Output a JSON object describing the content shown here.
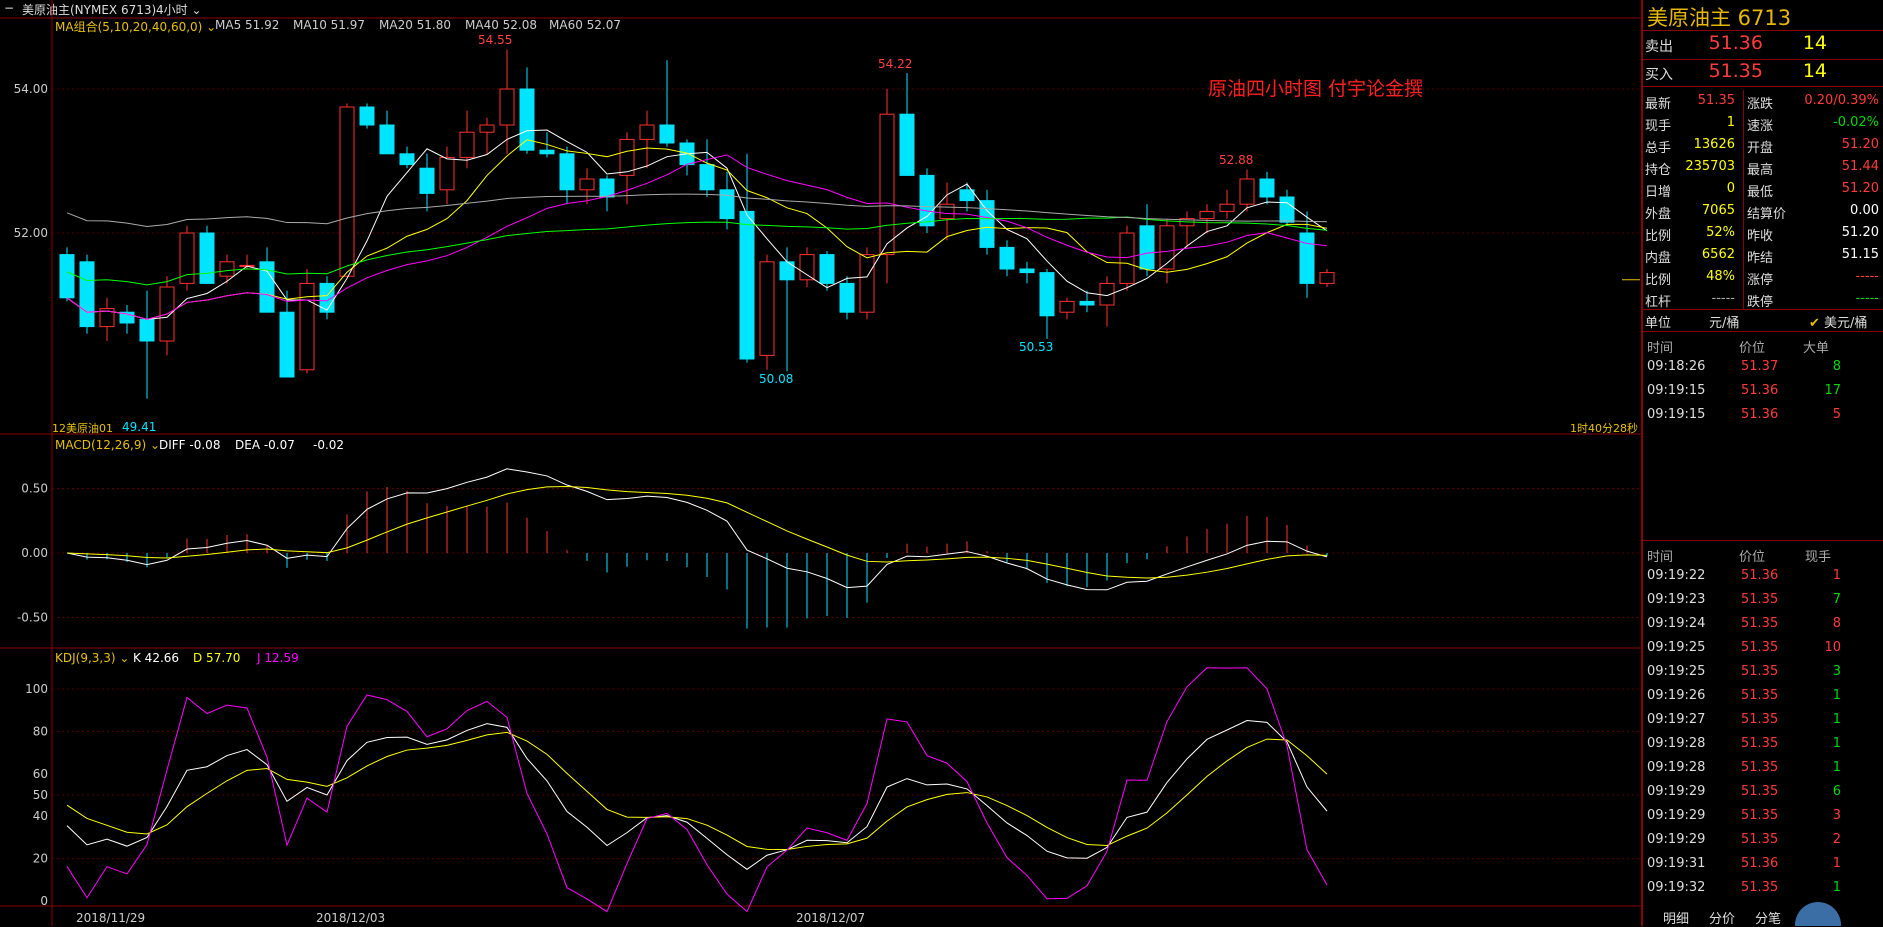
{
  "titlebar": {
    "icon": "minus-icon",
    "instrument": "美原油主(NYMEX 6713)",
    "period": "4小时"
  },
  "main": {
    "legend": {
      "name": "MA组合(5,10,20,40,60,0)",
      "items": [
        {
          "label": "MA5 51.92",
          "color": "#ffffff"
        },
        {
          "label": "MA10 51.97",
          "color": "#ffff00"
        },
        {
          "label": "MA20 51.80",
          "color": "#ff00ff"
        },
        {
          "label": "MA40 52.08",
          "color": "#00ff00"
        },
        {
          "label": "MA60 52.07",
          "color": "#aaaaaa"
        }
      ]
    },
    "watermark": "原油四小时图  付宇论金撰",
    "annotations": [
      "54.55",
      "54.22",
      "52.88",
      "50.08",
      "50.53",
      "49.41"
    ],
    "footer_left": "12美原油01",
    "footer_right": "1时40分28秒"
  },
  "macd": {
    "name": "MACD(12,26,9)",
    "items": [
      {
        "label": "DIFF -0.08",
        "color": "#ffffff"
      },
      {
        "label": "DEA -0.07",
        "color": "#ffff00"
      },
      {
        "label": "-0.02",
        "color": "#ffffff"
      }
    ]
  },
  "kdj": {
    "name": "KDJ(9,3,3)",
    "items": [
      {
        "label": "K 42.66",
        "color": "#ffffff"
      },
      {
        "label": "D 57.70",
        "color": "#ffff00"
      },
      {
        "label": "J 12.59",
        "color": "#ff00ff"
      }
    ]
  },
  "x_axis_dates": [
    "2018/11/29",
    "2018/12/03",
    "2018/12/07"
  ],
  "chart_data": {
    "type": "candlestick",
    "price_ylim": [
      49.0,
      55.0
    ],
    "price_ticks": [
      "54.00",
      "52.00"
    ],
    "macd_ticks": [
      "0.50",
      "0.00",
      "-0.50"
    ],
    "kdj_ticks": [
      "100",
      "80",
      "60",
      "50",
      "40",
      "20",
      "0"
    ],
    "candles": [
      {
        "o": 51.7,
        "h": 51.8,
        "l": 51.05,
        "c": 51.1
      },
      {
        "o": 51.6,
        "h": 51.7,
        "l": 50.6,
        "c": 50.7
      },
      {
        "o": 50.7,
        "h": 51.1,
        "l": 50.5,
        "c": 50.95
      },
      {
        "o": 50.9,
        "h": 51.0,
        "l": 50.6,
        "c": 50.75
      },
      {
        "o": 50.8,
        "h": 51.2,
        "l": 49.7,
        "c": 50.5
      },
      {
        "o": 50.5,
        "h": 51.4,
        "l": 50.3,
        "c": 51.25
      },
      {
        "o": 51.3,
        "h": 52.1,
        "l": 51.2,
        "c": 52.0
      },
      {
        "o": 52.0,
        "h": 52.1,
        "l": 51.3,
        "c": 51.3
      },
      {
        "o": 51.4,
        "h": 51.7,
        "l": 51.3,
        "c": 51.6
      },
      {
        "o": 51.55,
        "h": 51.7,
        "l": 51.5,
        "c": 51.55
      },
      {
        "o": 51.6,
        "h": 51.8,
        "l": 50.9,
        "c": 50.9
      },
      {
        "o": 50.9,
        "h": 51.2,
        "l": 50.0,
        "c": 50.0
      },
      {
        "o": 50.1,
        "h": 51.5,
        "l": 50.05,
        "c": 51.3
      },
      {
        "o": 51.3,
        "h": 51.4,
        "l": 50.8,
        "c": 50.9
      },
      {
        "o": 51.4,
        "h": 53.8,
        "l": 52.0,
        "c": 53.75
      },
      {
        "o": 53.75,
        "h": 53.8,
        "l": 53.45,
        "c": 53.5
      },
      {
        "o": 53.5,
        "h": 53.7,
        "l": 53.1,
        "c": 53.1
      },
      {
        "o": 53.1,
        "h": 53.2,
        "l": 52.9,
        "c": 52.95
      },
      {
        "o": 52.9,
        "h": 53.1,
        "l": 52.3,
        "c": 52.55
      },
      {
        "o": 52.6,
        "h": 53.2,
        "l": 52.4,
        "c": 53.05
      },
      {
        "o": 53.05,
        "h": 53.7,
        "l": 52.9,
        "c": 53.4
      },
      {
        "o": 53.4,
        "h": 53.6,
        "l": 53.1,
        "c": 53.5
      },
      {
        "o": 53.5,
        "h": 54.55,
        "l": 53.1,
        "c": 54.0
      },
      {
        "o": 54.0,
        "h": 54.3,
        "l": 53.1,
        "c": 53.15
      },
      {
        "o": 53.15,
        "h": 53.4,
        "l": 53.05,
        "c": 53.1
      },
      {
        "o": 53.1,
        "h": 53.2,
        "l": 52.4,
        "c": 52.6
      },
      {
        "o": 52.6,
        "h": 52.9,
        "l": 52.4,
        "c": 52.75
      },
      {
        "o": 52.75,
        "h": 52.8,
        "l": 52.3,
        "c": 52.5
      },
      {
        "o": 52.8,
        "h": 53.4,
        "l": 52.4,
        "c": 53.3
      },
      {
        "o": 53.3,
        "h": 53.7,
        "l": 52.9,
        "c": 53.5
      },
      {
        "o": 53.5,
        "h": 54.4,
        "l": 53.2,
        "c": 53.25
      },
      {
        "o": 53.25,
        "h": 53.3,
        "l": 52.8,
        "c": 52.95
      },
      {
        "o": 52.95,
        "h": 53.3,
        "l": 52.5,
        "c": 52.6
      },
      {
        "o": 52.6,
        "h": 52.85,
        "l": 52.05,
        "c": 52.2
      },
      {
        "o": 52.3,
        "h": 53.1,
        "l": 50.2,
        "c": 50.25
      },
      {
        "o": 50.3,
        "h": 51.7,
        "l": 50.1,
        "c": 51.6
      },
      {
        "o": 51.6,
        "h": 51.8,
        "l": 50.08,
        "c": 51.35
      },
      {
        "o": 51.35,
        "h": 51.8,
        "l": 51.25,
        "c": 51.7
      },
      {
        "o": 51.7,
        "h": 51.75,
        "l": 51.2,
        "c": 51.3
      },
      {
        "o": 51.3,
        "h": 51.4,
        "l": 50.8,
        "c": 50.9
      },
      {
        "o": 50.9,
        "h": 51.8,
        "l": 50.8,
        "c": 51.7
      },
      {
        "o": 51.7,
        "h": 54.0,
        "l": 51.3,
        "c": 53.65
      },
      {
        "o": 53.65,
        "h": 54.22,
        "l": 52.8,
        "c": 52.8
      },
      {
        "o": 52.8,
        "h": 52.9,
        "l": 52.0,
        "c": 52.1
      },
      {
        "o": 52.2,
        "h": 52.7,
        "l": 51.9,
        "c": 52.4
      },
      {
        "o": 52.6,
        "h": 52.7,
        "l": 52.3,
        "c": 52.45
      },
      {
        "o": 52.45,
        "h": 52.6,
        "l": 51.7,
        "c": 51.8
      },
      {
        "o": 51.8,
        "h": 51.9,
        "l": 51.4,
        "c": 51.5
      },
      {
        "o": 51.5,
        "h": 51.6,
        "l": 51.3,
        "c": 51.45
      },
      {
        "o": 51.45,
        "h": 51.5,
        "l": 50.53,
        "c": 50.85
      },
      {
        "o": 50.9,
        "h": 51.1,
        "l": 50.8,
        "c": 51.05
      },
      {
        "o": 51.05,
        "h": 51.2,
        "l": 50.9,
        "c": 51.0
      },
      {
        "o": 51.0,
        "h": 51.4,
        "l": 50.7,
        "c": 51.3
      },
      {
        "o": 51.3,
        "h": 52.1,
        "l": 51.2,
        "c": 52.0
      },
      {
        "o": 52.1,
        "h": 52.4,
        "l": 51.4,
        "c": 51.5
      },
      {
        "o": 51.5,
        "h": 52.2,
        "l": 51.3,
        "c": 52.1
      },
      {
        "o": 52.1,
        "h": 52.3,
        "l": 51.8,
        "c": 52.2
      },
      {
        "o": 52.2,
        "h": 52.4,
        "l": 52.0,
        "c": 52.3
      },
      {
        "o": 52.3,
        "h": 52.6,
        "l": 52.2,
        "c": 52.4
      },
      {
        "o": 52.4,
        "h": 52.88,
        "l": 52.3,
        "c": 52.75
      },
      {
        "o": 52.75,
        "h": 52.85,
        "l": 52.4,
        "c": 52.5
      },
      {
        "o": 52.5,
        "h": 52.6,
        "l": 52.1,
        "c": 52.15
      },
      {
        "o": 52.0,
        "h": 52.3,
        "l": 51.1,
        "c": 51.3
      },
      {
        "o": 51.3,
        "h": 51.5,
        "l": 51.25,
        "c": 51.45
      }
    ]
  },
  "quote": {
    "title": "美原油主  6713",
    "sell": {
      "label": "卖出",
      "price": "51.36",
      "qty": "14"
    },
    "buy": {
      "label": "买入",
      "price": "51.35",
      "qty": "14"
    },
    "rows": [
      {
        "l1": "最新",
        "v1": "51.35",
        "c1": "red",
        "l2": "涨跌",
        "v2": "0.20/0.39%",
        "c2": "red"
      },
      {
        "l1": "现手",
        "v1": "1",
        "c1": "yellow",
        "l2": "速涨",
        "v2": "-0.02%",
        "c2": "green"
      },
      {
        "l1": "总手",
        "v1": "13626",
        "c1": "yellow",
        "l2": "开盘",
        "v2": "51.20",
        "c2": "red"
      },
      {
        "l1": "持仓",
        "v1": "235703",
        "c1": "yellow",
        "l2": "最高",
        "v2": "51.44",
        "c2": "red"
      },
      {
        "l1": "日增",
        "v1": "0",
        "c1": "yellow",
        "l2": "最低",
        "v2": "51.20",
        "c2": "red"
      },
      {
        "l1": "外盘",
        "v1": "7065",
        "c1": "yellow",
        "l2": "结算价",
        "v2": "0.00",
        "c2": "white"
      },
      {
        "l1": "比例",
        "v1": "52%",
        "c1": "yellow",
        "l2": "昨收",
        "v2": "51.20",
        "c2": "white"
      },
      {
        "l1": "内盘",
        "v1": "6562",
        "c1": "yellow",
        "l2": "昨结",
        "v2": "51.15",
        "c2": "white"
      },
      {
        "l1": "比例",
        "v1": "48%",
        "c1": "yellow",
        "l2": "涨停",
        "v2": "-----",
        "c2": "red"
      },
      {
        "l1": "杠杆",
        "v1": "-----",
        "c1": "gray",
        "l2": "跌停",
        "v2": "-----",
        "c2": "green"
      }
    ],
    "unit_label": "单位",
    "unit_cny": "元/桶",
    "unit_usd": "美元/桶",
    "big_headers": [
      "时间",
      "价位",
      "大单"
    ],
    "big_orders": [
      {
        "t": "09:18:26",
        "p": "51.37",
        "q": "8",
        "qc": "green"
      },
      {
        "t": "09:19:15",
        "p": "51.36",
        "q": "17",
        "qc": "green"
      },
      {
        "t": "09:19:15",
        "p": "51.36",
        "q": "5",
        "qc": "red"
      }
    ],
    "tick_headers": [
      "时间",
      "价位",
      "现手"
    ],
    "ticks": [
      {
        "t": "09:19:22",
        "p": "51.36",
        "q": "1",
        "qc": "red"
      },
      {
        "t": "09:19:23",
        "p": "51.35",
        "q": "7",
        "qc": "green"
      },
      {
        "t": "09:19:24",
        "p": "51.35",
        "q": "8",
        "qc": "red"
      },
      {
        "t": "09:19:25",
        "p": "51.35",
        "q": "10",
        "qc": "red"
      },
      {
        "t": "09:19:25",
        "p": "51.35",
        "q": "3",
        "qc": "green"
      },
      {
        "t": "09:19:26",
        "p": "51.35",
        "q": "1",
        "qc": "green"
      },
      {
        "t": "09:19:27",
        "p": "51.35",
        "q": "1",
        "qc": "green"
      },
      {
        "t": "09:19:28",
        "p": "51.35",
        "q": "1",
        "qc": "green"
      },
      {
        "t": "09:19:28",
        "p": "51.35",
        "q": "1",
        "qc": "green"
      },
      {
        "t": "09:19:29",
        "p": "51.35",
        "q": "6",
        "qc": "green"
      },
      {
        "t": "09:19:29",
        "p": "51.35",
        "q": "3",
        "qc": "red"
      },
      {
        "t": "09:19:29",
        "p": "51.35",
        "q": "2",
        "qc": "red"
      },
      {
        "t": "09:19:31",
        "p": "51.36",
        "q": "1",
        "qc": "red"
      },
      {
        "t": "09:19:32",
        "p": "51.35",
        "q": "1",
        "qc": "green"
      }
    ],
    "tabs": [
      "明细",
      "分价",
      "分笔"
    ]
  }
}
